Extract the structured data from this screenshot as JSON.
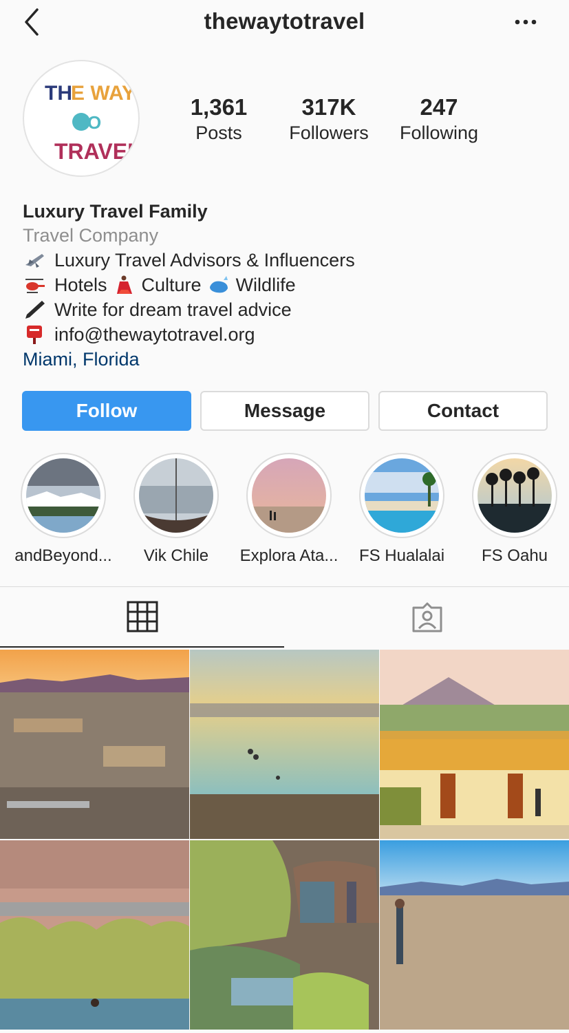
{
  "header": {
    "username": "thewaytotravel",
    "back_icon": "chevron-left-icon",
    "more_icon": "ellipsis-icon"
  },
  "profile": {
    "avatar_alt": "THE WAY TO TRAVEL",
    "stats": [
      {
        "value": "1,361",
        "label": "Posts"
      },
      {
        "value": "317K",
        "label": "Followers"
      },
      {
        "value": "247",
        "label": "Following"
      }
    ],
    "name": "Luxury Travel Family",
    "category": "Travel Company",
    "bio_lines": {
      "line1": "Luxury Travel Advisors & Influencers",
      "line2_a": "Hotels",
      "line2_b": "Culture",
      "line2_c": "Wildlife",
      "line3": "Write for dream travel advice",
      "line4": "info@thewaytotravel.org"
    },
    "location": "Miami, Florida"
  },
  "actions": {
    "follow": "Follow",
    "message": "Message",
    "contact": "Contact"
  },
  "highlights": [
    {
      "label": "andBeyond..."
    },
    {
      "label": "Vik Chile"
    },
    {
      "label": "Explora Ata..."
    },
    {
      "label": "FS Hualalai"
    },
    {
      "label": "FS Oahu"
    }
  ],
  "tabs": {
    "grid_icon": "grid-icon",
    "tagged_icon": "tagged-person-icon"
  },
  "colors": {
    "accent": "#3897f0",
    "link": "#00376b",
    "muted": "#8e8e8e",
    "border": "#dbdbdb"
  }
}
